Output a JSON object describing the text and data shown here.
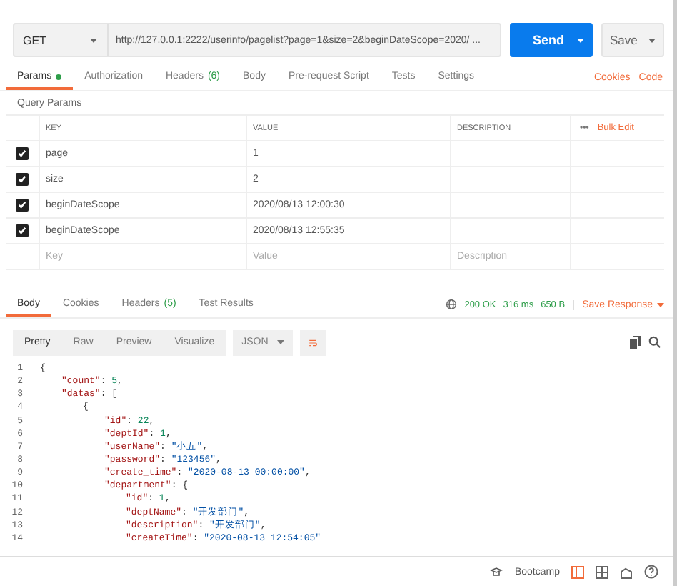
{
  "request": {
    "method": "GET",
    "url": "http://127.0.0.1:2222/userinfo/pagelist?page=1&size=2&beginDateScope=2020/ ...",
    "send": "Send",
    "save": "Save"
  },
  "request_tabs": [
    {
      "label": "Params",
      "selected": true,
      "dot": true
    },
    {
      "label": "Authorization",
      "selected": false
    },
    {
      "label": "Headers",
      "count": "(6)",
      "selected": false
    },
    {
      "label": "Body",
      "selected": false
    },
    {
      "label": "Pre-request Script",
      "selected": false
    },
    {
      "label": "Tests",
      "selected": false
    },
    {
      "label": "Settings",
      "selected": false
    }
  ],
  "links": [
    "Cookies",
    "Code"
  ],
  "query_params": {
    "title": "Query Params",
    "columns": [
      "KEY",
      "VALUE",
      "DESCRIPTION"
    ],
    "more": "•••",
    "bulk_edit": "Bulk Edit",
    "rows": [
      {
        "key": "page",
        "value": "1",
        "checked": true
      },
      {
        "key": "size",
        "value": "2",
        "checked": true
      },
      {
        "key": "beginDateScope",
        "value": "2020/08/13 12:00:30",
        "checked": true
      },
      {
        "key": "beginDateScope",
        "value": "2020/08/13 12:55:35",
        "checked": true
      }
    ],
    "new_row": [
      {
        "placeholder": "Key"
      },
      {
        "placeholder": "Value"
      },
      {
        "placeholder": "Description"
      }
    ]
  },
  "response_tabs": [
    {
      "label": "Body",
      "selected": true
    },
    {
      "label": "Cookies",
      "selected": false
    },
    {
      "label": "Headers",
      "count": "(5)",
      "selected": false
    },
    {
      "label": "Test Results",
      "selected": false
    }
  ],
  "status": {
    "code": "200 OK",
    "time": "316 ms",
    "size": "650 B",
    "save_response": "Save Response"
  },
  "view_modes": [
    {
      "label": "Pretty",
      "selected": true
    },
    {
      "label": "Raw",
      "selected": false
    },
    {
      "label": "Preview",
      "selected": false
    },
    {
      "label": "Visualize",
      "selected": false
    }
  ],
  "format": "JSON",
  "code_lines": [
    {
      "n": "1",
      "tokens": [
        {
          "kind": "punct",
          "text": "{"
        }
      ],
      "children": [
        {
          "n": "2",
          "tokens": [
            {
              "kind": "key",
              "text": "\"count\""
            },
            {
              "kind": "punct",
              "text": ": "
            },
            {
              "kind": "num",
              "text": "5"
            },
            {
              "kind": "punct",
              "text": ","
            }
          ]
        },
        {
          "n": "3",
          "tokens": [
            {
              "kind": "key",
              "text": "\"datas\""
            },
            {
              "kind": "punct",
              "text": ": ["
            }
          ],
          "children": [
            {
              "n": "4",
              "tokens": [
                {
                  "kind": "punct",
                  "text": "{"
                }
              ],
              "children": [
                {
                  "n": "5",
                  "tokens": [
                    {
                      "kind": "key",
                      "text": "\"id\""
                    },
                    {
                      "kind": "punct",
                      "text": ": "
                    },
                    {
                      "kind": "num",
                      "text": "22"
                    },
                    {
                      "kind": "punct",
                      "text": ","
                    }
                  ]
                },
                {
                  "n": "6",
                  "tokens": [
                    {
                      "kind": "key",
                      "text": "\"deptId\""
                    },
                    {
                      "kind": "punct",
                      "text": ": "
                    },
                    {
                      "kind": "num",
                      "text": "1"
                    },
                    {
                      "kind": "punct",
                      "text": ","
                    }
                  ]
                },
                {
                  "n": "7",
                  "tokens": [
                    {
                      "kind": "key",
                      "text": "\"userName\""
                    },
                    {
                      "kind": "punct",
                      "text": ": "
                    },
                    {
                      "kind": "str",
                      "text": "\"小五\""
                    },
                    {
                      "kind": "punct",
                      "text": ","
                    }
                  ]
                },
                {
                  "n": "8",
                  "tokens": [
                    {
                      "kind": "key",
                      "text": "\"password\""
                    },
                    {
                      "kind": "punct",
                      "text": ": "
                    },
                    {
                      "kind": "str",
                      "text": "\"123456\""
                    },
                    {
                      "kind": "punct",
                      "text": ","
                    }
                  ]
                },
                {
                  "n": "9",
                  "tokens": [
                    {
                      "kind": "key",
                      "text": "\"create_time\""
                    },
                    {
                      "kind": "punct",
                      "text": ": "
                    },
                    {
                      "kind": "str",
                      "text": "\"2020-08-13 00:00:00\""
                    },
                    {
                      "kind": "punct",
                      "text": ","
                    }
                  ]
                },
                {
                  "n": "10",
                  "tokens": [
                    {
                      "kind": "key",
                      "text": "\"department\""
                    },
                    {
                      "kind": "punct",
                      "text": ": {"
                    }
                  ],
                  "children": [
                    {
                      "n": "11",
                      "tokens": [
                        {
                          "kind": "key",
                          "text": "\"id\""
                        },
                        {
                          "kind": "punct",
                          "text": ": "
                        },
                        {
                          "kind": "num",
                          "text": "1"
                        },
                        {
                          "kind": "punct",
                          "text": ","
                        }
                      ]
                    },
                    {
                      "n": "12",
                      "tokens": [
                        {
                          "kind": "key",
                          "text": "\"deptName\""
                        },
                        {
                          "kind": "punct",
                          "text": ": "
                        },
                        {
                          "kind": "str",
                          "text": "\"开发部门\""
                        },
                        {
                          "kind": "punct",
                          "text": ","
                        }
                      ]
                    },
                    {
                      "n": "13",
                      "tokens": [
                        {
                          "kind": "key",
                          "text": "\"description\""
                        },
                        {
                          "kind": "punct",
                          "text": ": "
                        },
                        {
                          "kind": "str",
                          "text": "\"开发部门\""
                        },
                        {
                          "kind": "punct",
                          "text": ","
                        }
                      ]
                    },
                    {
                      "n": "14",
                      "tokens": [
                        {
                          "kind": "key",
                          "text": "\"createTime\""
                        },
                        {
                          "kind": "punct",
                          "text": ": "
                        },
                        {
                          "kind": "str",
                          "text": "\"2020-08-13 12:54:05\""
                        }
                      ]
                    }
                  ]
                }
              ]
            }
          ]
        }
      ]
    }
  ],
  "footer": {
    "bootcamp": "Bootcamp"
  }
}
